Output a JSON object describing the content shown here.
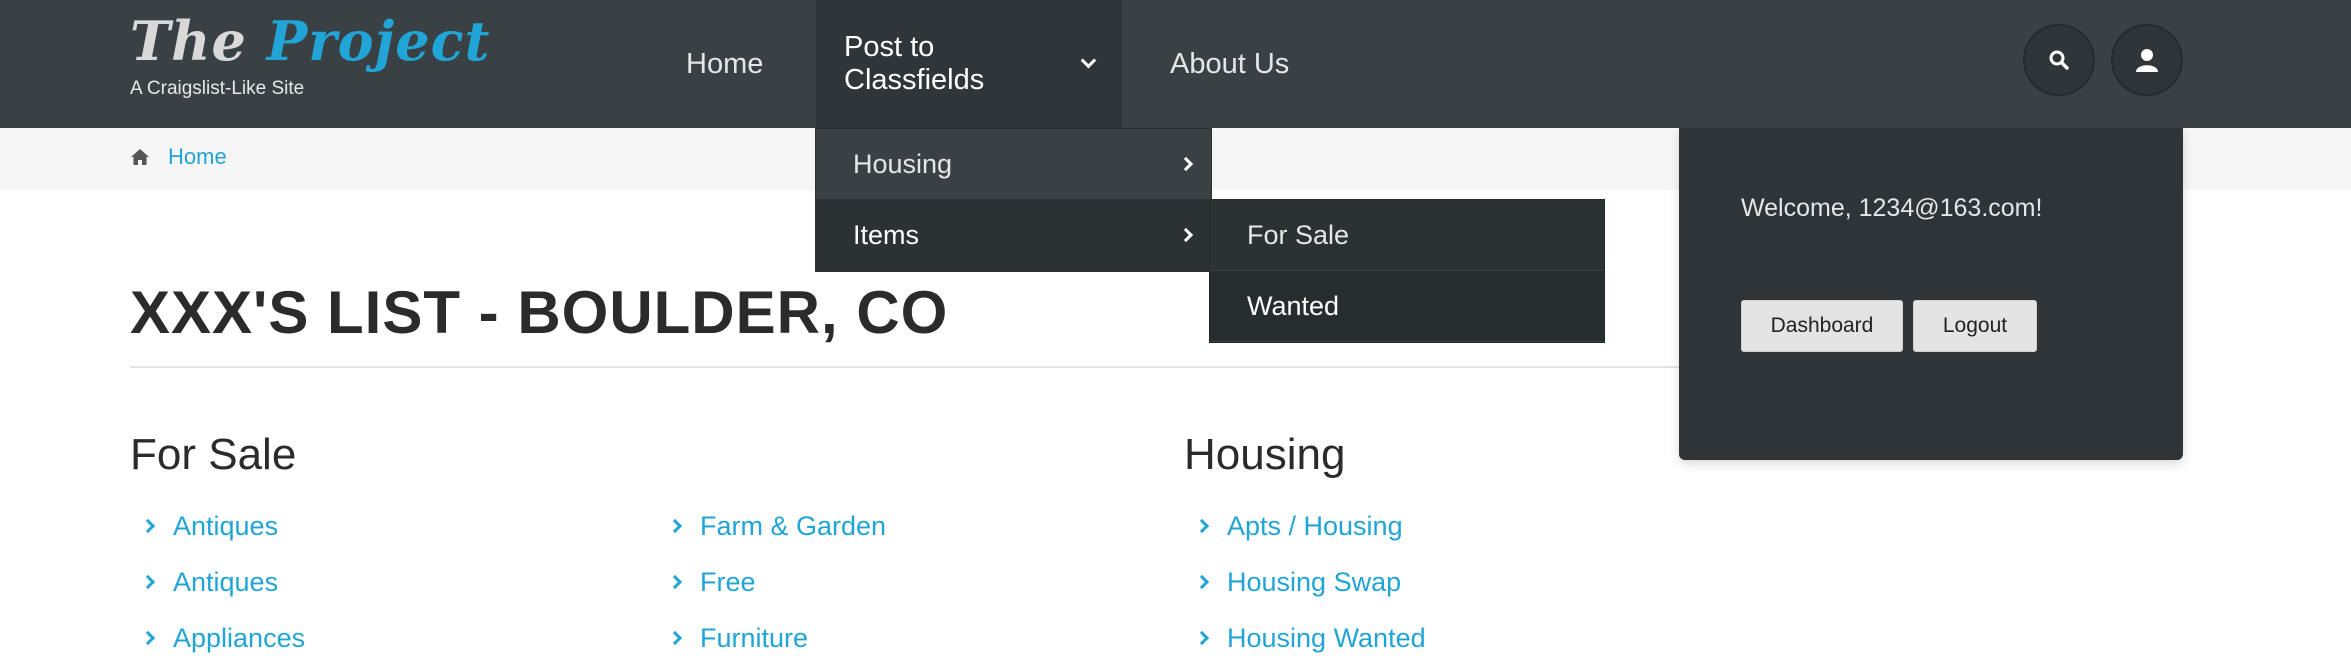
{
  "brand": {
    "name_part1": "The ",
    "name_part2": "Project",
    "tagline": "A Craigslist-Like Site",
    "accent_color": "#21a4d6"
  },
  "nav": {
    "home": "Home",
    "post": "Post to Classfields",
    "about": "About Us",
    "icons": {
      "search": "search-icon",
      "user": "user-icon",
      "post_caret": "chevron-down-icon"
    }
  },
  "dropdown": {
    "items": [
      {
        "label": "Housing",
        "icon": "chevron-right-icon"
      },
      {
        "label": "Items",
        "icon": "chevron-right-icon"
      }
    ],
    "submenu": [
      {
        "label": "For Sale"
      },
      {
        "label": "Wanted"
      }
    ]
  },
  "user_panel": {
    "welcome": "Welcome, 1234@163.com!",
    "dashboard": "Dashboard",
    "logout": "Logout"
  },
  "breadcrumb": {
    "home": "Home",
    "icon": "home-icon"
  },
  "page": {
    "title": "XXX'S LIST - BOULDER, CO",
    "sections": [
      {
        "heading": "For Sale",
        "col1": [
          "Antiques",
          "Antiques",
          "Appliances"
        ],
        "col2": [
          "Farm & Garden",
          "Free",
          "Furniture"
        ]
      },
      {
        "heading": "Housing",
        "col1": [
          "Apts / Housing",
          "Housing Swap",
          "Housing Wanted"
        ]
      }
    ]
  }
}
